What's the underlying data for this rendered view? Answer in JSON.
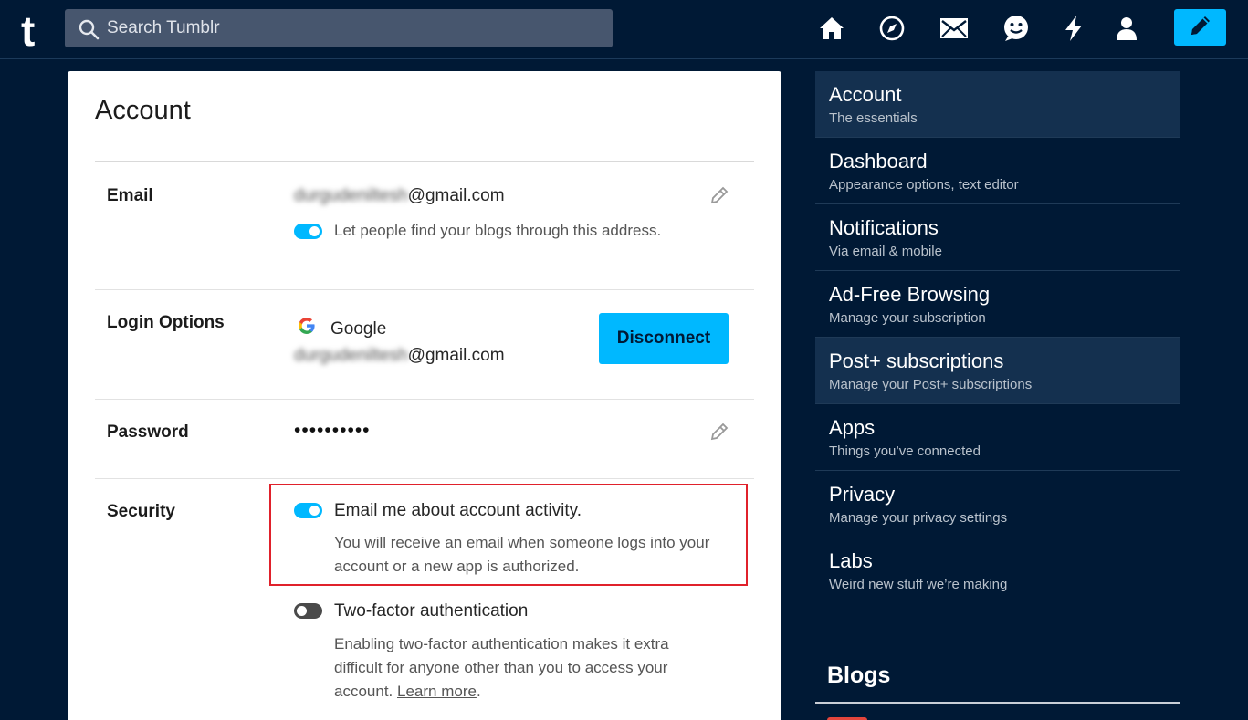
{
  "header": {
    "logo": "t",
    "search_placeholder": "Search Tumblr",
    "nav_icons": [
      "home-icon",
      "explore-icon",
      "inbox-icon",
      "messaging-icon",
      "activity-icon",
      "account-icon"
    ],
    "compose_icon": "pencil-icon"
  },
  "account": {
    "title": "Account",
    "email": {
      "label": "Email",
      "address_user": "durgudeniltesh",
      "address_domain": "@gmail.com",
      "findable_text": "Let people find your blogs through this address.",
      "findable_on": true
    },
    "login_options": {
      "label": "Login Options",
      "provider": "Google",
      "email_user": "durgudeniltesh",
      "email_domain": "@gmail.com",
      "disconnect_label": "Disconnect"
    },
    "password": {
      "label": "Password",
      "masked": "••••••••••"
    },
    "security": {
      "label": "Security",
      "email_activity_title": "Email me about account activity.",
      "email_activity_desc_1": "You will receive an email when someone logs into your",
      "email_activity_desc_2": "account or a new app is authorized.",
      "email_activity_on": true,
      "two_factor_title": "Two-factor authentication",
      "two_factor_desc_1": "Enabling two-factor authentication makes it extra",
      "two_factor_desc_2": "difficult for anyone other than you to access your",
      "two_factor_desc_3_prefix": "account.",
      "two_factor_learn_more": "Learn more",
      "two_factor_desc_3_suffix": ".",
      "two_factor_on": false
    }
  },
  "sidebar": {
    "items": [
      {
        "title": "Account",
        "sub": "The essentials",
        "active": true
      },
      {
        "title": "Dashboard",
        "sub": "Appearance options, text editor",
        "active": false
      },
      {
        "title": "Notifications",
        "sub": "Via email & mobile",
        "active": false
      },
      {
        "title": "Ad-Free Browsing",
        "sub": "Manage your subscription",
        "active": false
      },
      {
        "title": "Post+ subscriptions",
        "sub": "Manage your Post+ subscriptions",
        "active": true
      },
      {
        "title": "Apps",
        "sub": "Things you’ve connected",
        "active": false
      },
      {
        "title": "Privacy",
        "sub": "Manage your privacy settings",
        "active": false
      },
      {
        "title": "Labs",
        "sub": "Weird new stuff we’re making",
        "active": false
      }
    ],
    "blogs_heading": "Blogs"
  },
  "colors": {
    "background": "#001935",
    "accent": "#00b8ff",
    "highlight_border": "#e0212b"
  }
}
